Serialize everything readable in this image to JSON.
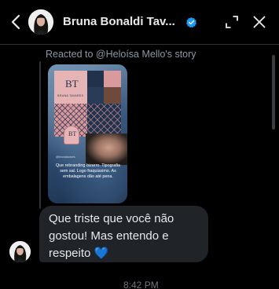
{
  "header": {
    "name": "Bruna Bonaldi Tav...",
    "icons": {
      "back": "back-arrow-icon",
      "verified": "verified-badge-icon",
      "expand": "expand-icon",
      "close": "close-icon"
    },
    "accent_color": "#1d9bf0"
  },
  "reply_context": {
    "reacted_text": "Reacted to @Heloísa Mello's story"
  },
  "story": {
    "monogram": "BT",
    "brand_label": "BRUNA TAVARES",
    "handle": "@brunatavares",
    "caption": "Que rebranding bizarro. Tipografia sem sal. Logo fraquissimo. As embalagens dão até pena."
  },
  "message": {
    "text": "Que triste que você não gostou! Mas entendo e respeito 💙"
  },
  "timestamp": "8:42 PM"
}
